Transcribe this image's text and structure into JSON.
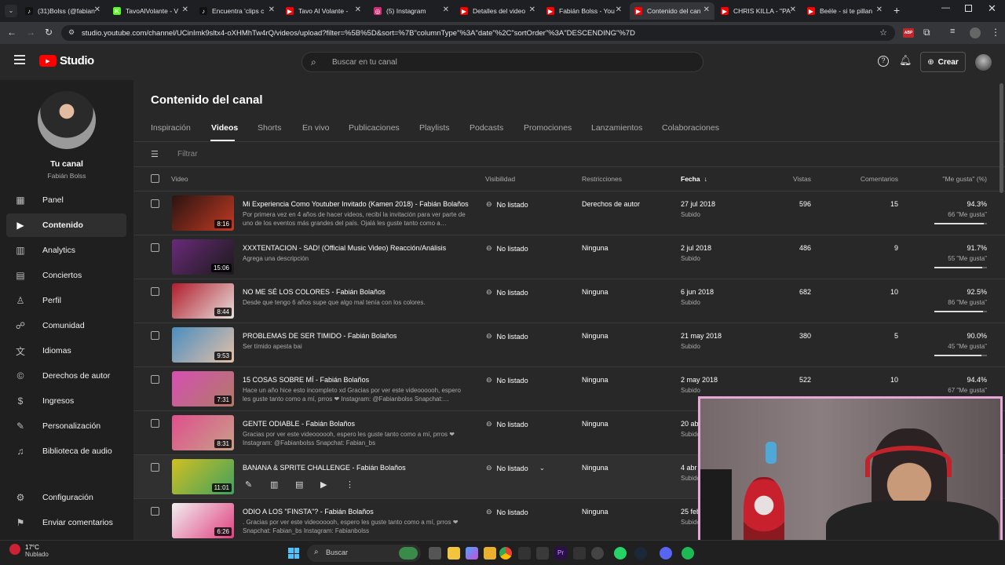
{
  "browser": {
    "tabs": [
      {
        "title": "(31)Bolss (@fabian",
        "color": "#111",
        "glyph": "♪"
      },
      {
        "title": "TavoAlVolante - V",
        "color": "#53fc18",
        "glyph": "K"
      },
      {
        "title": "Encuentra 'clips c",
        "color": "#111",
        "glyph": "♪"
      },
      {
        "title": "Tavo Al Volante -",
        "color": "#ff0000",
        "glyph": "▶"
      },
      {
        "title": "(5) Instagram",
        "color": "#d62976",
        "glyph": "◎"
      },
      {
        "title": "Detalles del video",
        "color": "#ff0000",
        "glyph": "▶"
      },
      {
        "title": "Fabián Bolss - You",
        "color": "#ff0000",
        "glyph": "▶"
      },
      {
        "title": "Contenido del can",
        "color": "#ff0000",
        "glyph": "▶"
      },
      {
        "title": "CHRIS KILLA - \"PA",
        "color": "#ff0000",
        "glyph": "▶"
      },
      {
        "title": "Beéle - si te pillan",
        "color": "#ff0000",
        "glyph": "▶"
      }
    ],
    "url": "studio.youtube.com/channel/UCinImk9sltx4-oXHMhTw4rQ/videos/upload?filter=%5B%5D&sort=%7B\"columnType\"%3A\"date\"%2C\"sortOrder\"%3A\"DESCENDING\"%7D",
    "abp_label": "ABP"
  },
  "header": {
    "logo_text": "Studio",
    "search_placeholder": "Buscar en tu canal",
    "create_label": "Crear"
  },
  "sidebar": {
    "channel_label": "Tu canal",
    "channel_name": "Fabián Bolss",
    "items": [
      {
        "label": "Panel",
        "icon": "grid-icon"
      },
      {
        "label": "Contenido",
        "icon": "play-icon"
      },
      {
        "label": "Analytics",
        "icon": "chart-icon"
      },
      {
        "label": "Conciertos",
        "icon": "calendar-icon"
      },
      {
        "label": "Perfil",
        "icon": "person-icon"
      },
      {
        "label": "Comunidad",
        "icon": "community-icon"
      },
      {
        "label": "Idiomas",
        "icon": "translate-icon"
      },
      {
        "label": "Derechos de autor",
        "icon": "copyright-icon"
      },
      {
        "label": "Ingresos",
        "icon": "dollar-icon"
      },
      {
        "label": "Personalización",
        "icon": "brush-icon"
      },
      {
        "label": "Biblioteca de audio",
        "icon": "audio-library-icon"
      }
    ],
    "settings_label": "Configuración",
    "feedback_label": "Enviar comentarios"
  },
  "main": {
    "title": "Contenido del canal",
    "tabs": [
      "Inspiración",
      "Videos",
      "Shorts",
      "En vivo",
      "Publicaciones",
      "Playlists",
      "Podcasts",
      "Promociones",
      "Lanzamientos",
      "Colaboraciones"
    ],
    "active_tab": "Videos",
    "filter_placeholder": "Filtrar",
    "columns": {
      "video": "Video",
      "visibility": "Visibilidad",
      "restrictions": "Restricciones",
      "date": "Fecha",
      "views": "Vistas",
      "comments": "Comentarios",
      "likes": "\"Me gusta\" (%)"
    },
    "rows": [
      {
        "title": "Mi Experiencia Como Youtuber Invitado (Kamen 2018) - Fabián Bolaños",
        "desc": "Por primera vez en 4 años de hacer videos, recibí la invitación para ver parte de uno de los eventos más grandes del país. Ojalá les guste tanto como a…",
        "duration": "8:16",
        "visibility": "No listado",
        "restrictions": "Derechos de autor",
        "date": "27 jul 2018",
        "date_sub": "Subido",
        "views": "596",
        "comments": "15",
        "likes_pct": "94.3%",
        "likes_count": "66 \"Me gusta\"",
        "likes_frac": 0.943,
        "thumb": [
          "#2a1410",
          "#c23a24"
        ]
      },
      {
        "title": "XXXTENTACION - SAD! (Official Music Video) Reacción/Análisis",
        "desc": "Agrega una descripción",
        "duration": "15:06",
        "visibility": "No listado",
        "restrictions": "Ninguna",
        "date": "2 jul 2018",
        "date_sub": "Subido",
        "views": "486",
        "comments": "9",
        "likes_pct": "91.7%",
        "likes_count": "55 \"Me gusta\"",
        "likes_frac": 0.917,
        "thumb": [
          "#6a2a7a",
          "#1a1a1a"
        ]
      },
      {
        "title": "NO ME SÉ LOS COLORES - Fabián Bolaños",
        "desc": "Desde que tengo 6 años supe que algo mal tenía con los colores.",
        "duration": "8:44",
        "visibility": "No listado",
        "restrictions": "Ninguna",
        "date": "6 jun 2018",
        "date_sub": "Subido",
        "views": "682",
        "comments": "10",
        "likes_pct": "92.5%",
        "likes_count": "86 \"Me gusta\"",
        "likes_frac": 0.925,
        "thumb": [
          "#b01c2c",
          "#e8e0dc"
        ]
      },
      {
        "title": "PROBLEMAS DE SER TIMIDO - Fabián Bolaños",
        "desc": "Ser tímido apesta bai",
        "duration": "9:53",
        "visibility": "No listado",
        "restrictions": "Ninguna",
        "date": "21 may 2018",
        "date_sub": "Subido",
        "views": "380",
        "comments": "5",
        "likes_pct": "90.0%",
        "likes_count": "45 \"Me gusta\"",
        "likes_frac": 0.9,
        "thumb": [
          "#4a8ec0",
          "#e4c0a8"
        ]
      },
      {
        "title": "15 COSAS SOBRE MÍ - Fabián Bolaños",
        "desc": "Hace un año hice esto incompleto xd Gracias por ver este videoooooh, espero les guste tanto como a mí, prros ❤ Instagram: @Fabianbolss Snapchat:…",
        "duration": "7:31",
        "visibility": "No listado",
        "restrictions": "Ninguna",
        "date": "2 may 2018",
        "date_sub": "Subido",
        "views": "522",
        "comments": "10",
        "likes_pct": "94.4%",
        "likes_count": "67 \"Me gusta\"",
        "likes_frac": 0.944,
        "thumb": [
          "#d64fb4",
          "#b07a66"
        ]
      },
      {
        "title": "GENTE ODIABLE - Fabián Bolaños",
        "desc": "Gracias por ver este videoooooh, espero les guste tanto como a mí, prros ❤ Instagram: @Fabianbolss Snapchat: Fabian_bs",
        "duration": "8:31",
        "visibility": "No listado",
        "restrictions": "Ninguna",
        "date": "20 abr 2018",
        "date_sub": "Subido",
        "views": "",
        "comments": "",
        "likes_pct": "",
        "likes_count": "",
        "likes_frac": null,
        "thumb": [
          "#e04e8e",
          "#c8a088"
        ]
      },
      {
        "title": "BANANA & SPRITE CHALLENGE - Fabián Bolaños",
        "desc": "",
        "duration": "11:01",
        "visibility": "No listado",
        "restrictions": "Ninguna",
        "date": "4 abr 2018",
        "date_sub": "Subido",
        "views": "",
        "comments": "",
        "likes_pct": "",
        "likes_count": "",
        "likes_frac": null,
        "thumb": [
          "#d0c020",
          "#40a060"
        ],
        "hovered": true
      },
      {
        "title": "ODIO A LOS \"FINSTA\"? - Fabián Bolaños",
        "desc": ". Gracias por ver este videoooooh, espero les guste tanto como a mí, prros ❤ Snapchat: Fabian_bs Instagram: Fabianbolss",
        "duration": "6:26",
        "visibility": "No listado",
        "restrictions": "Ninguna",
        "date": "25 feb 2018",
        "date_sub": "Subido",
        "views": "",
        "comments": "",
        "likes_pct": "",
        "likes_count": "",
        "likes_frac": null,
        "thumb": [
          "#f0f0f0",
          "#e04080"
        ]
      }
    ]
  },
  "taskbar": {
    "weather_temp": "17°C",
    "weather_desc": "Nublado",
    "search_placeholder": "Buscar"
  },
  "colors": {
    "yt_red": "#ff0000",
    "webcam_border": "#e6a6d6"
  }
}
